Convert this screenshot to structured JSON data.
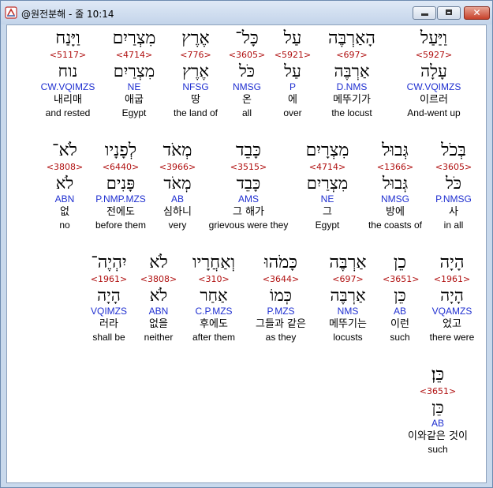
{
  "window": {
    "title": "@원전분해 - 줄 10:14",
    "controls": {
      "minimize": "minimize",
      "maximize": "maximize",
      "close": "✕"
    }
  },
  "rows": [
    {
      "words": [
        {
          "heb": "וַיַּעַל",
          "strong": "<5927>",
          "lex": "עָלָה",
          "parse": "CW.VQIMZS",
          "kor": "이르러",
          "eng": "And-went up",
          "selected": true
        },
        {
          "heb": "הָאַרְבֶּה",
          "strong": "<697>",
          "lex": "אַרְבֶּה",
          "parse": "D.NMS",
          "kor": "메뚜기가",
          "eng": "the locust"
        },
        {
          "heb": "עַל",
          "strong": "<5921>",
          "lex": "עַל",
          "parse": "P",
          "kor": "에",
          "eng": "over"
        },
        {
          "heb": "כָּל־",
          "strong": "<3605>",
          "lex": "כֹּל",
          "parse": "NMSG",
          "kor": "온",
          "eng": "all"
        },
        {
          "heb": "אֶרֶץ",
          "strong": "<776>",
          "lex": "אֶרֶץ",
          "parse": "NFSG",
          "kor": "땅",
          "eng": "the land of"
        },
        {
          "heb": "מִצְרַיִם",
          "strong": "<4714>",
          "lex": "מִצְרַיִם",
          "parse": "NE",
          "kor": "애굽",
          "eng": "Egypt"
        },
        {
          "heb": "וַיָּנַח",
          "strong": "<5117>",
          "lex": "נוח",
          "parse": "CW.VQIMZS",
          "kor": "내리매",
          "eng": "and rested"
        }
      ]
    },
    {
      "words": [
        {
          "heb": "בְּכֹל",
          "strong": "<3605>",
          "lex": "כֹּל",
          "parse": "P.NMSG",
          "kor": "사",
          "eng": "in all"
        },
        {
          "heb": "גְּבוּל",
          "strong": "<1366>",
          "lex": "גְּבוּל",
          "parse": "NMSG",
          "kor": "방에",
          "eng": "the coasts of"
        },
        {
          "heb": "מִצְרָיִם",
          "strong": "<4714>",
          "lex": "מִצְרַיִם",
          "parse": "NE",
          "kor": "그",
          "eng": "Egypt"
        },
        {
          "heb": "כָּבֵד",
          "strong": "<3515>",
          "lex": "כָּבֵד",
          "parse": "AMS",
          "kor": "그 해가",
          "eng": "grievous were they"
        },
        {
          "heb": "מְאֹד",
          "strong": "<3966>",
          "lex": "מְאֹד",
          "parse": "AB",
          "kor": "심하니",
          "eng": "very"
        },
        {
          "heb": "לְפָנָיו",
          "strong": "<6440>",
          "lex": "פָּנִים",
          "parse": "P.NMP.MZS",
          "kor": "전에도",
          "eng": "before them"
        },
        {
          "heb": "לֹא־",
          "strong": "<3808>",
          "lex": "לֹא",
          "parse": "ABN",
          "kor": "없",
          "eng": "no"
        }
      ]
    },
    {
      "words": [
        {
          "heb": "הָיָה",
          "strong": "<1961>",
          "lex": "הָיָה",
          "parse": "VQAMZS",
          "kor": "었고",
          "eng": "there were"
        },
        {
          "heb": "כֵן",
          "strong": "<3651>",
          "lex": "כֵּן",
          "parse": "AB",
          "kor": "이런",
          "eng": "such"
        },
        {
          "heb": "אַרְבֶּה",
          "strong": "<697>",
          "lex": "אַרְבֶּה",
          "parse": "NMS",
          "kor": "메뚜기는",
          "eng": "locusts"
        },
        {
          "heb": "כָּמֹהוּ",
          "strong": "<3644>",
          "lex": "כְּמוֹ",
          "parse": "P.MZS",
          "kor": "그들과 같은",
          "eng": "as they"
        },
        {
          "heb": "וְאַחֲרָיו",
          "strong": "<310>",
          "lex": "אַחַר",
          "parse": "C.P.MZS",
          "kor": "후에도",
          "eng": "after them"
        },
        {
          "heb": "לֹא",
          "strong": "<3808>",
          "lex": "לֹא",
          "parse": "ABN",
          "kor": "없을",
          "eng": "neither"
        },
        {
          "heb": "יִהְיֶה־",
          "strong": "<1961>",
          "lex": "הָיָה",
          "parse": "VQIMZS",
          "kor": "러라",
          "eng": "shall be"
        }
      ]
    },
    {
      "words": [
        {
          "heb": "כֵּן׃",
          "strong": "<3651>",
          "lex": "כֵּן",
          "parse": "AB",
          "kor": "이와같은 것이",
          "eng": "such"
        }
      ]
    }
  ]
}
